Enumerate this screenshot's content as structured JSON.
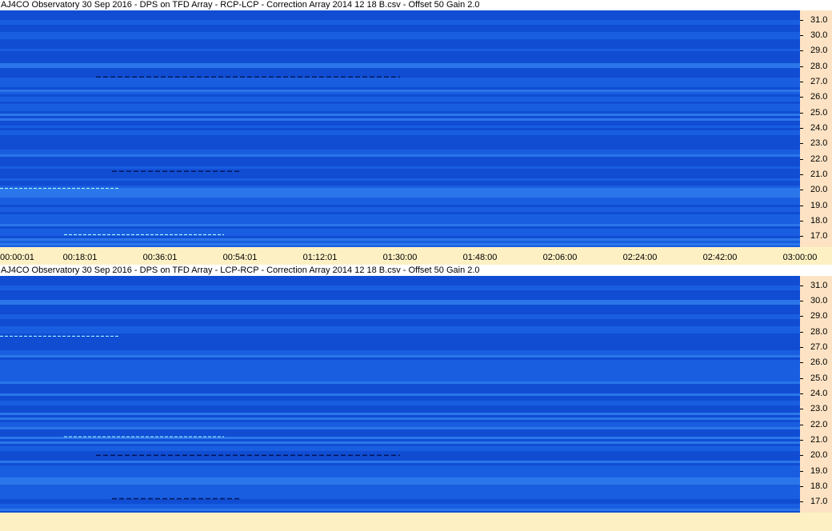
{
  "panels": [
    {
      "title": "AJ4CO Observatory 30 Sep 2016  -  DPS on TFD Array  -  RCP-LCP  -  Correction Array 2014 12 18 B.csv  -  Offset 50  Gain 2.0",
      "dark_streak_rows": [
        "27.3",
        "21.2"
      ],
      "bright_streak_rows": [
        "20.1",
        "17.1"
      ]
    },
    {
      "title": "AJ4CO Observatory 30 Sep 2016  -  DPS on TFD Array  -  LCP-RCP  -  Correction Array 2014 12 18 B.csv  -  Offset 50  Gain 2.0",
      "dark_streak_rows": [
        "20.0",
        "17.2"
      ],
      "bright_streak_rows": [
        "27.7",
        "21.2"
      ]
    }
  ],
  "chart_data": {
    "type": "heatmap",
    "x_ticks": [
      "00:00:01",
      "00:18:01",
      "00:36:01",
      "00:54:01",
      "01:12:01",
      "01:30:00",
      "01:48:00",
      "02:06:00",
      "02:24:00",
      "02:42:00",
      "03:00:00"
    ],
    "y_ticks": [
      "31.0",
      "30.0",
      "29.0",
      "28.0",
      "27.0",
      "26.0",
      "25.0",
      "24.0",
      "23.0",
      "22.0",
      "21.0",
      "20.0",
      "19.0",
      "18.0",
      "17.0"
    ],
    "ylim": [
      16.3,
      31.6
    ],
    "colors": {
      "base": "#1a5ee0",
      "dark": "#0a3fc8",
      "light": "#3a8af2",
      "streak_dark": "#05155a",
      "streak_bright": "#9ff2ff",
      "freq_axis_bg": "#fde3c4",
      "time_axis_bg": "#fdf1c4"
    }
  }
}
